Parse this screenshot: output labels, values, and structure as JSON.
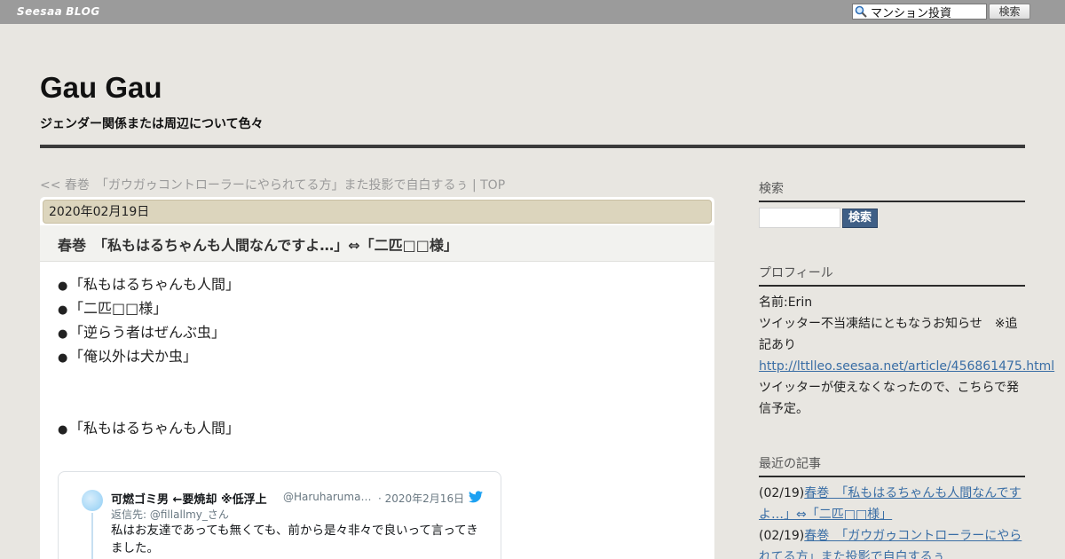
{
  "topbar": {
    "brand": "Seesaa",
    "brand_suffix": "BLOG",
    "search_value": "マンション投資",
    "search_button": "検索",
    "search_icon": "magnifier-icon"
  },
  "header": {
    "title": "Gau Gau",
    "description": "ジェンダー関係または周辺について色々"
  },
  "nav": {
    "prev": "<< 春巻　「ガウガゥコントローラーにやられてる方」また投影で自白するぅ",
    "separator": " | ",
    "top": "TOP"
  },
  "article": {
    "date": "2020年02月19日",
    "title": "春巻　「私もはるちゃんも人間なんですよ…」⇔「二匹□□様」",
    "bullet": "●",
    "items": [
      "「私もはるちゃんも人間」",
      "「二匹□□様」",
      "「逆らう者はぜんぶ虫」",
      "「俺以外は犬か虫」"
    ],
    "item_after": "「私もはるちゃんも人間」"
  },
  "tweet": {
    "author": "可燃ゴミ男 ←要焼却 ※低浮上",
    "handle": "@Haruharuma…",
    "date": "· 2020年2月16日",
    "reply_prefix": "返信先: ",
    "reply_to": "@fillallmy_さん",
    "text": "私はお友達であっても無くても、前から是々非々で良いって言ってきました。",
    "icon": "twitter-bird-icon",
    "colors": {
      "bird": "#1da1f2",
      "meta": "#697882"
    }
  },
  "sidebar": {
    "search": {
      "heading": "検索",
      "button": "検索"
    },
    "profile": {
      "heading": "プロフィール",
      "name": "名前:Erin",
      "notice": "ツイッター不当凍結にともなうお知らせ　※追記あり",
      "link": "http://lttlleo.seesaa.net/article/456861475.html",
      "note": "ツイッターが使えなくなったので、こちらで発信予定。"
    },
    "recent": {
      "heading": "最近の記事",
      "items": [
        {
          "date": "(02/19)",
          "title": "春巻　「私もはるちゃんも人間なんですよ…」⇔「二匹□□様」"
        },
        {
          "date": "(02/19)",
          "title": "春巻　「ガウガゥコントローラーにやられてる方」また投影で自白するぅ"
        }
      ]
    }
  },
  "colors": {
    "page_bg": "#e8e6e1",
    "topbar_bg": "#9b9b9b",
    "date_bar": "#dcd5bd",
    "link": "#3a6ea5",
    "side_button": "#3f5f86"
  }
}
